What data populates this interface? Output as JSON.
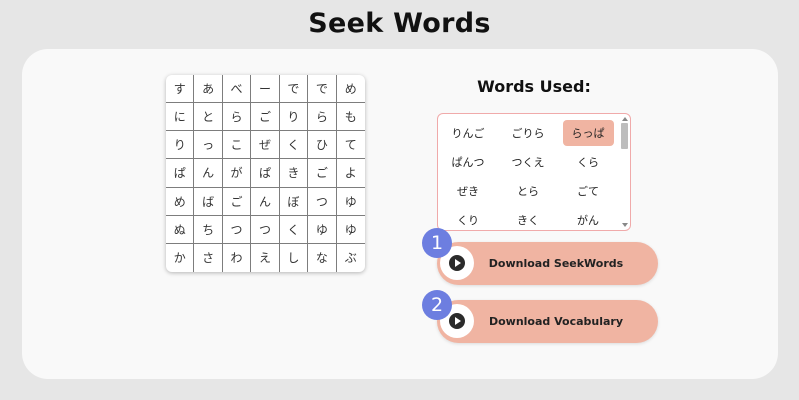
{
  "page": {
    "title": "Seek Words"
  },
  "grid": {
    "rows": [
      [
        "す",
        "あ",
        "べ",
        "ー",
        "で",
        "で",
        "め"
      ],
      [
        "に",
        "と",
        "ら",
        "ご",
        "り",
        "ら",
        "も"
      ],
      [
        "り",
        "っ",
        "こ",
        "ぜ",
        "く",
        "ひ",
        "て"
      ],
      [
        "ぱ",
        "ん",
        "が",
        "ぱ",
        "き",
        "ご",
        "よ"
      ],
      [
        "め",
        "ば",
        "ご",
        "ん",
        "ぼ",
        "つ",
        "ゆ"
      ],
      [
        "ぬ",
        "ち",
        "つ",
        "つ",
        "く",
        "ゆ",
        "ゆ"
      ],
      [
        "か",
        "さ",
        "わ",
        "え",
        "し",
        "な",
        "ぶ"
      ]
    ]
  },
  "words": {
    "title": "Words Used:",
    "items": [
      {
        "text": "りんご",
        "selected": false
      },
      {
        "text": "ごりら",
        "selected": false
      },
      {
        "text": "らっぱ",
        "selected": true
      },
      {
        "text": "ぱんつ",
        "selected": false
      },
      {
        "text": "つくえ",
        "selected": false
      },
      {
        "text": "くら",
        "selected": false
      },
      {
        "text": "ぜき",
        "selected": false
      },
      {
        "text": "とら",
        "selected": false
      },
      {
        "text": "ごて",
        "selected": false
      },
      {
        "text": "くり",
        "selected": false
      },
      {
        "text": "きく",
        "selected": false
      },
      {
        "text": "がん",
        "selected": false
      }
    ]
  },
  "buttons": {
    "download_seekwords": {
      "label": "Download SeekWords",
      "badge": "1",
      "icon": "play-icon"
    },
    "download_vocabulary": {
      "label": "Download Vocabulary",
      "badge": "2",
      "icon": "play-icon"
    }
  },
  "colors": {
    "accent": "#f0b4a2",
    "badge": "#6d7ee0",
    "list_border": "#f0aaaa"
  }
}
